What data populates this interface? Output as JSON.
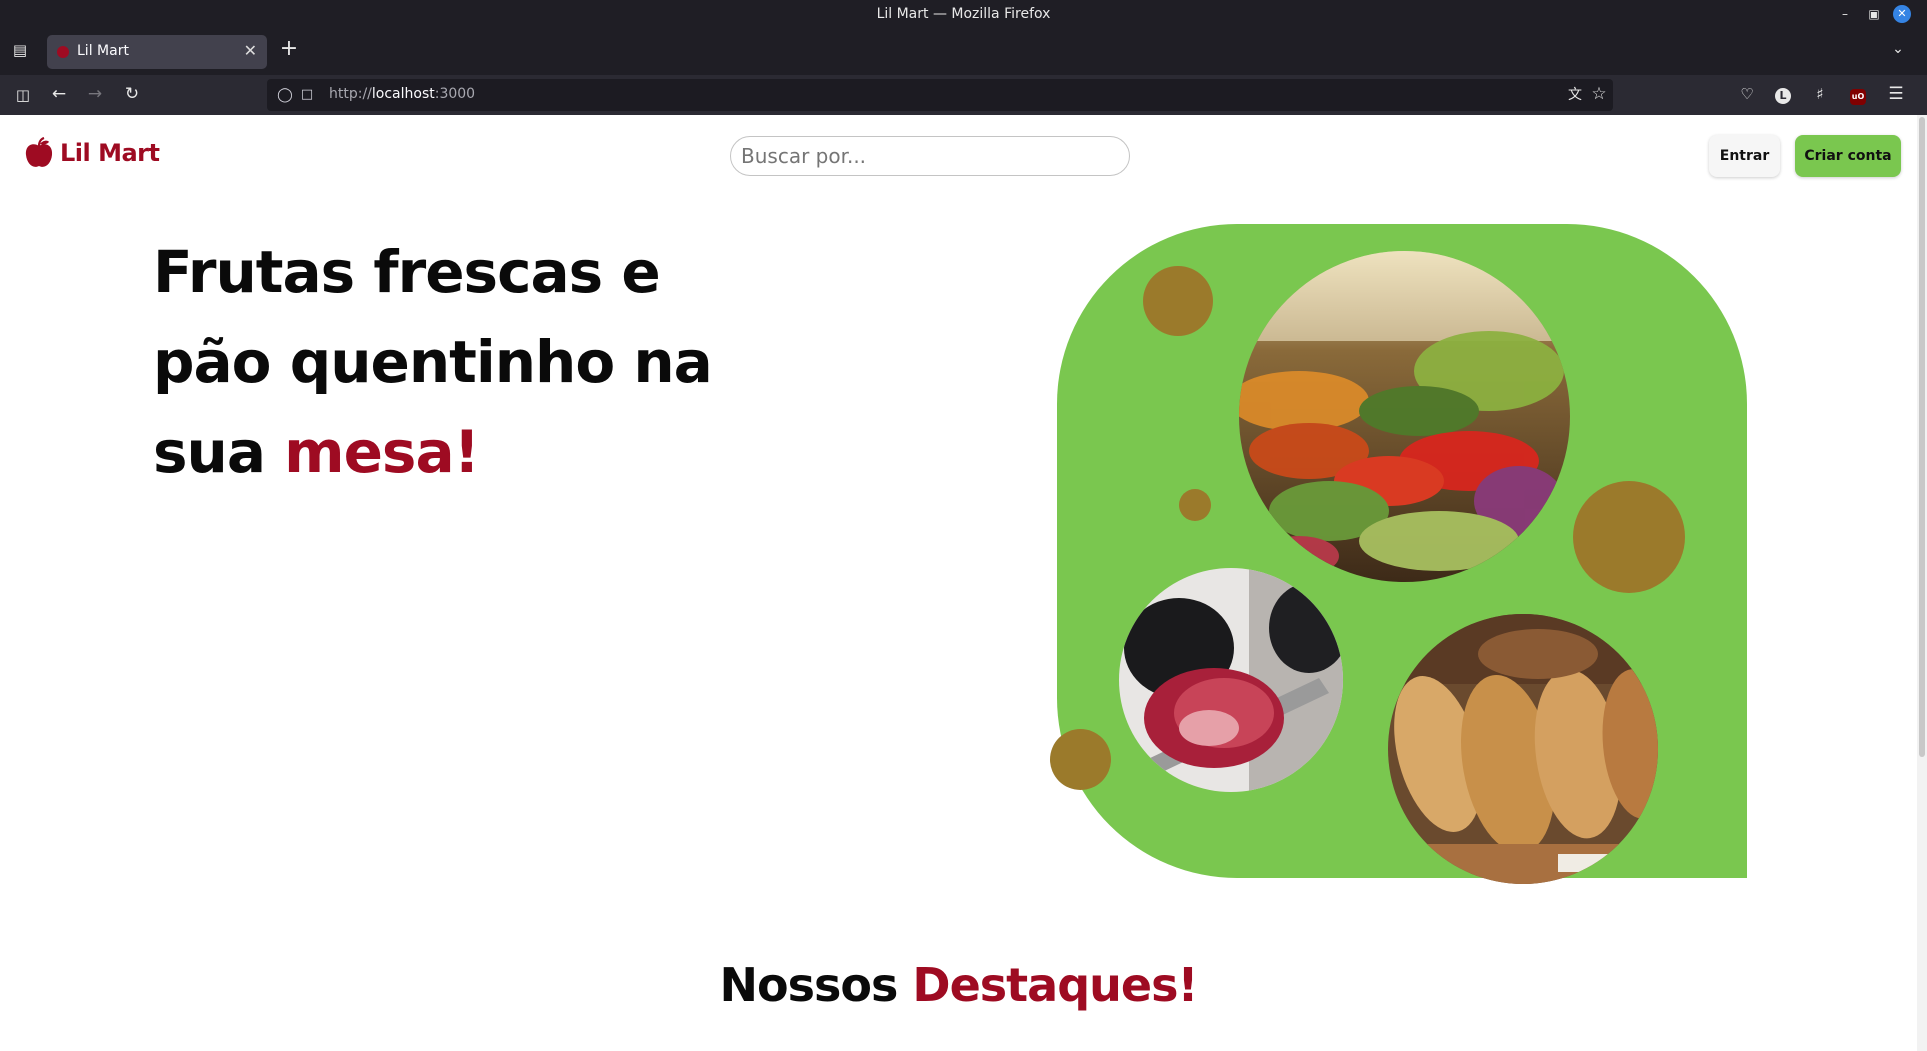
{
  "browser": {
    "window_title": "Lil Mart — Mozilla Firefox",
    "tab_title": "Lil Mart",
    "url_prefix": "http://",
    "url_host": "localhost",
    "url_port": ":3000"
  },
  "header": {
    "brand": "Lil Mart",
    "search_placeholder": "Buscar por...",
    "login_label": "Entrar",
    "signup_label": "Criar conta"
  },
  "hero": {
    "title_lines": [
      "Frutas frescas e",
      "pão quentinho na"
    ],
    "title_last": "sua ",
    "title_accent": "mesa!",
    "photos": [
      "produce-market-photo",
      "meat-cutting-photo",
      "bread-loaves-photo"
    ]
  },
  "featured": {
    "title": "Nossos ",
    "title_accent": "Destaques!"
  },
  "colors": {
    "brand": "#9e0b22",
    "green": "#7ac74f",
    "ochre": "#9b7a2b"
  }
}
